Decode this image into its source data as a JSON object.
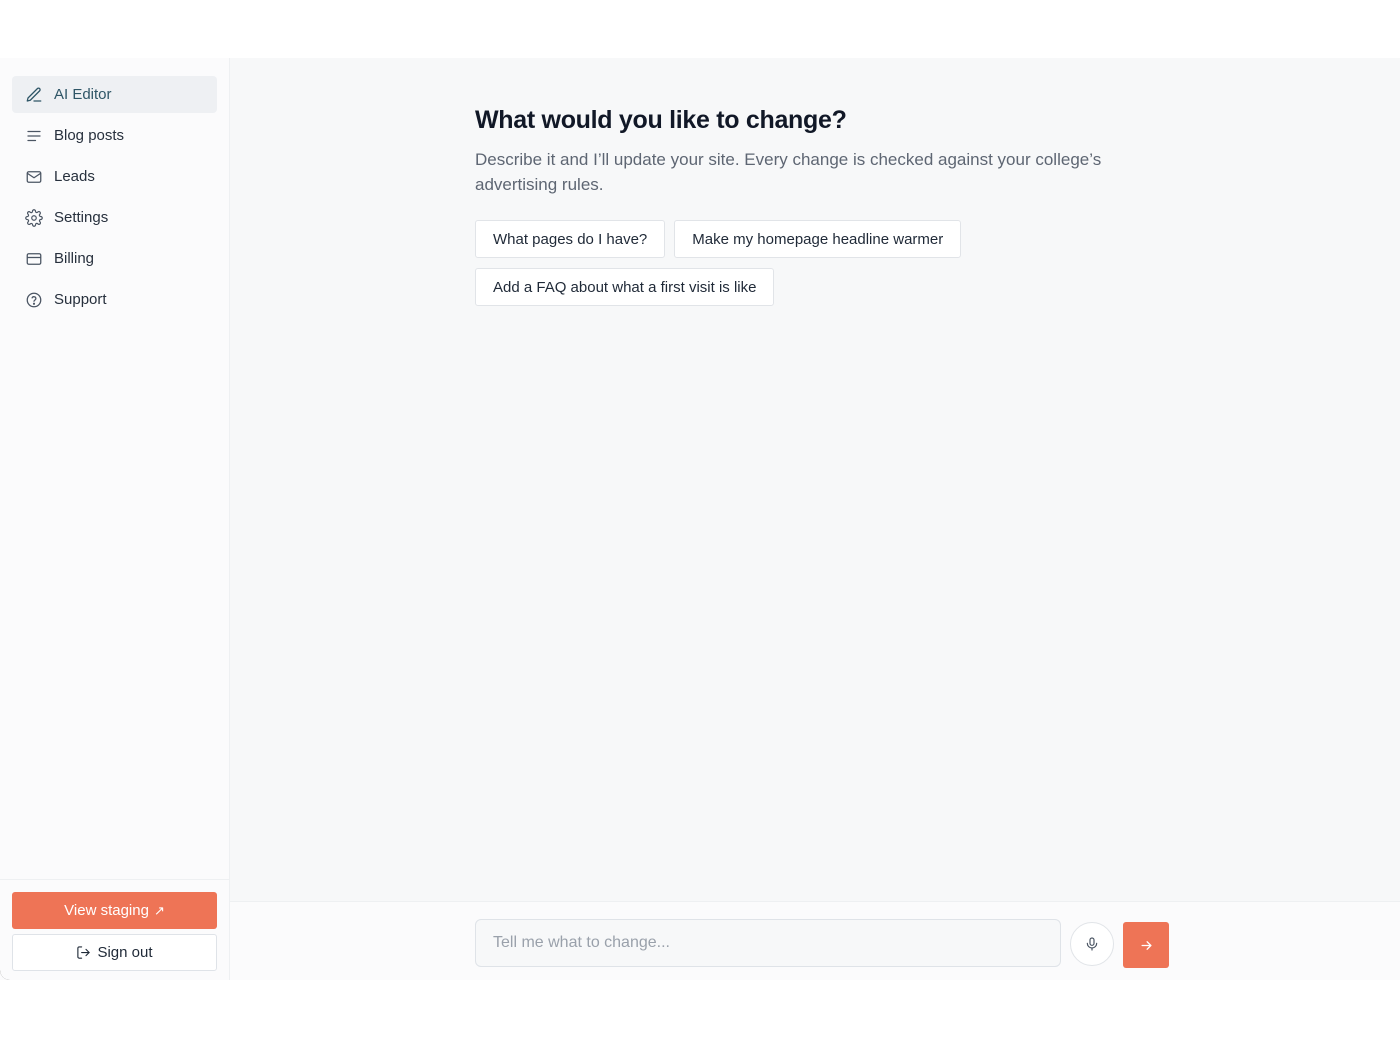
{
  "sidebar": {
    "items": [
      {
        "label": "AI Editor",
        "icon": "pencil-icon",
        "active": true
      },
      {
        "label": "Blog posts",
        "icon": "lines-icon",
        "active": false
      },
      {
        "label": "Leads",
        "icon": "mail-icon",
        "active": false
      },
      {
        "label": "Settings",
        "icon": "gear-icon",
        "active": false
      },
      {
        "label": "Billing",
        "icon": "credit-card-icon",
        "active": false
      },
      {
        "label": "Support",
        "icon": "help-circle-icon",
        "active": false
      }
    ],
    "view_staging_label": "View staging",
    "view_staging_icon": "↗",
    "sign_out_label": "Sign out"
  },
  "main": {
    "heading": "What would you like to change?",
    "subtext": "Describe it and I’ll update your site. Every change is checked against your college’s advertising rules.",
    "suggestions": [
      "What pages do I have?",
      "Make my homepage headline warmer",
      "Add a FAQ about what a first visit is like"
    ]
  },
  "composer": {
    "placeholder": "Tell me what to change...",
    "value": ""
  },
  "colors": {
    "accent": "#ee7456",
    "active_nav_bg": "#eef0f3",
    "active_nav_text": "#2e5566"
  }
}
